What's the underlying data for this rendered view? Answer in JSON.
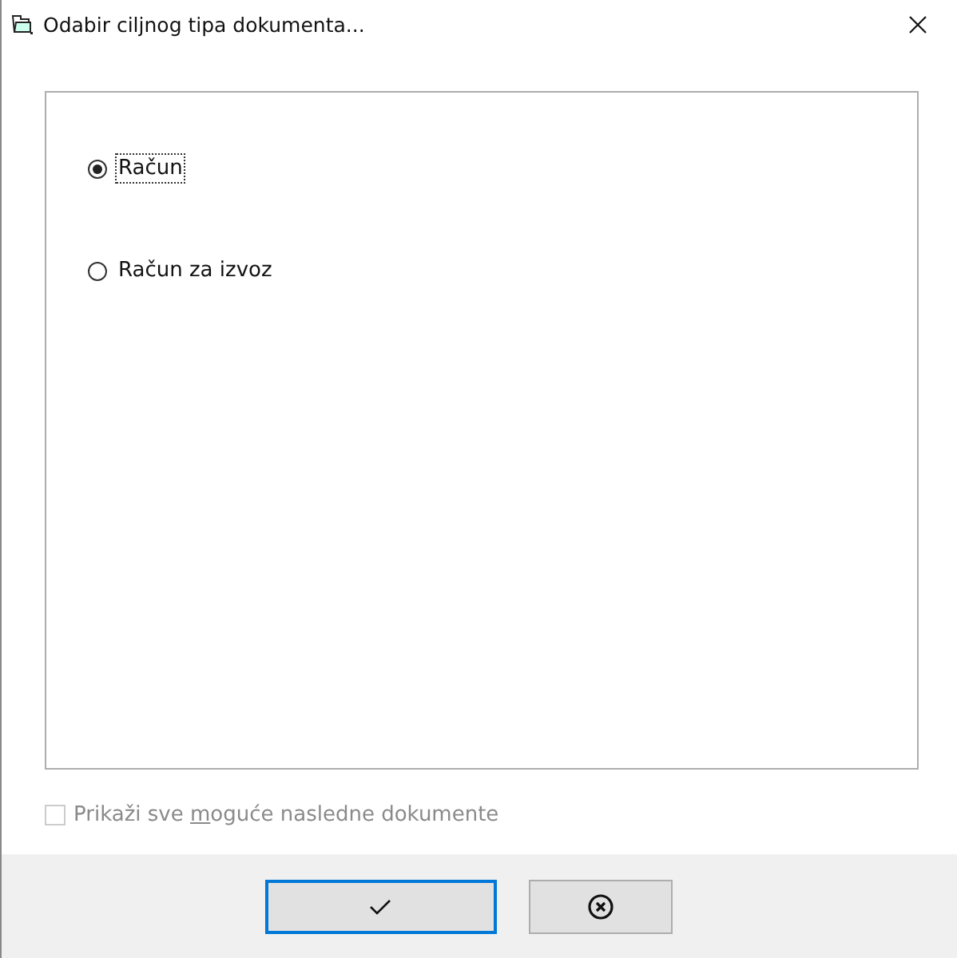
{
  "window": {
    "title": "Odabir ciljnog tipa dokumenta..."
  },
  "options": [
    {
      "label": "Račun",
      "selected": true,
      "focused": true
    },
    {
      "label": "Račun za izvoz",
      "selected": false,
      "focused": false
    }
  ],
  "show_all": {
    "before": "Prikaži sve ",
    "access_key": "m",
    "after": "oguće nasledne dokumente",
    "checked": false,
    "disabled": true
  },
  "buttons": [
    {
      "kind": "ok",
      "default": true
    },
    {
      "kind": "cancel",
      "default": false
    }
  ]
}
